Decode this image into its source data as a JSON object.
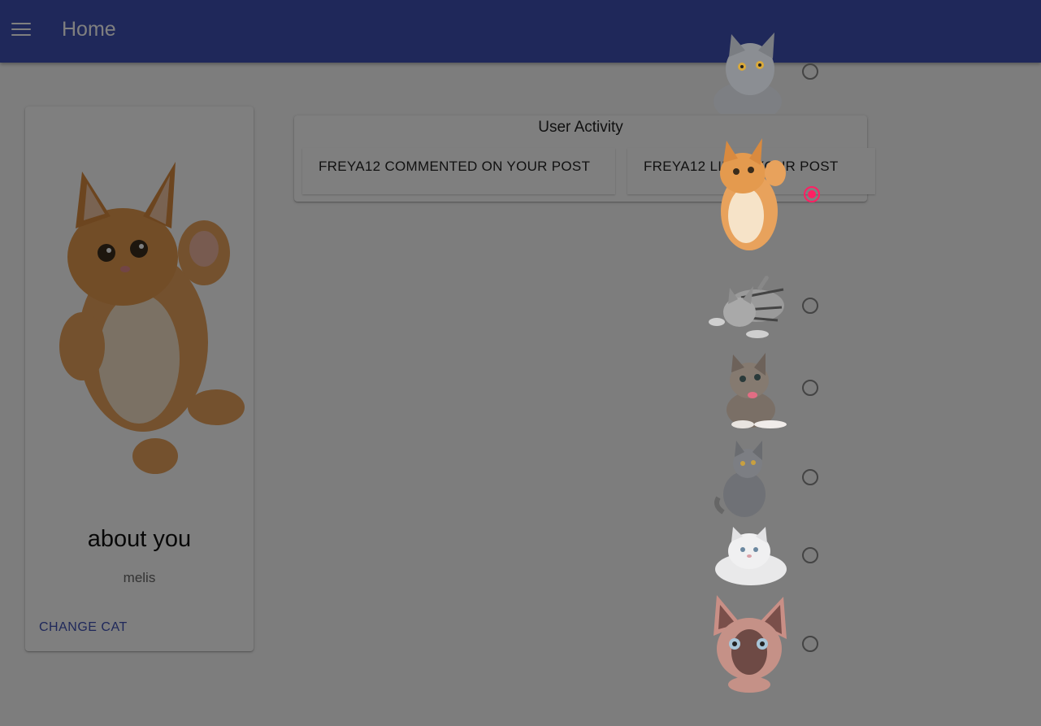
{
  "appbar": {
    "menu_icon": "hamburger-menu-icon",
    "title": "Home"
  },
  "profile": {
    "image": "orange-kitten",
    "heading": "about you",
    "username": "melis",
    "change_button": "CHANGE CAT"
  },
  "activity": {
    "title": "User Activity",
    "items": [
      "FREYA12 COMMENTED ON YOUR POST",
      "FREYA12 LIKED YOUR POST"
    ]
  },
  "cat_picker": {
    "accent_color": "#ff1f63",
    "options": [
      {
        "image": "gray-cat-looking-up",
        "selected": false
      },
      {
        "image": "orange-kitten",
        "selected": true
      },
      {
        "image": "tabby-kitten-playing",
        "selected": false
      },
      {
        "image": "tabby-kitten-sitting",
        "selected": false
      },
      {
        "image": "gray-cat-sitting",
        "selected": false
      },
      {
        "image": "white-persian-cat",
        "selected": false
      },
      {
        "image": "sphynx-cat",
        "selected": false
      }
    ]
  },
  "colors": {
    "primary": "#3f51b5",
    "scrim": "rgba(0,0,0,0.5)"
  }
}
